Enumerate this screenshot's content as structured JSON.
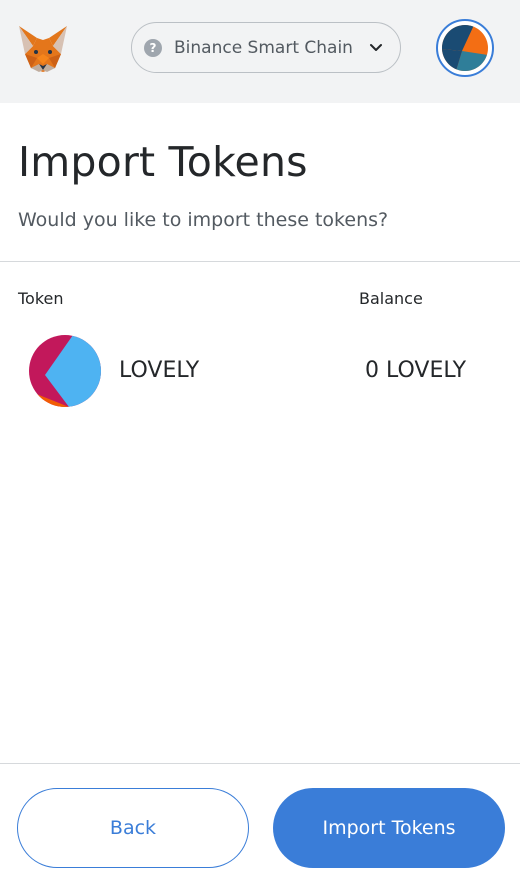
{
  "header": {
    "logo_icon": "metamask-fox-icon",
    "network": {
      "icon": "question-icon",
      "icon_glyph": "?",
      "label": "Binance Smart Chain",
      "chevron_icon": "chevron-down-icon"
    },
    "account_icon": "account-avatar-icon",
    "accent_color": "#3a7dd8"
  },
  "page": {
    "title": "Import Tokens",
    "subtitle": "Would you like to import these tokens?"
  },
  "table": {
    "columns": [
      "Token",
      "Balance"
    ],
    "rows": [
      {
        "avatar_icon": "token-identicon",
        "symbol": "LOVELY",
        "balance": "0 LOVELY"
      }
    ]
  },
  "footer": {
    "back_label": "Back",
    "import_label": "Import Tokens"
  }
}
